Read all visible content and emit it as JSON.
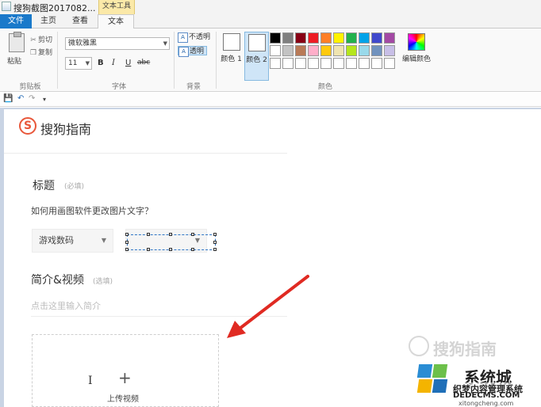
{
  "window": {
    "title": "搜狗截图2017082...",
    "context_tab": "文本工具"
  },
  "tabs": {
    "file": "文件",
    "home": "主页",
    "view": "查看",
    "text": "文本"
  },
  "ribbon": {
    "clipboard": {
      "paste": "粘贴",
      "cut": "剪切",
      "copy": "复制",
      "group": "剪贴板"
    },
    "font": {
      "family": "微软雅黑",
      "size": "11",
      "bold": "B",
      "italic": "I",
      "underline": "U",
      "strike": "abc",
      "group": "字体"
    },
    "background": {
      "opaque": "不透明",
      "transparent": "透明",
      "group": "背景"
    },
    "colors": {
      "color1": "颜色 1",
      "color2": "颜色 2",
      "edit": "编辑颜色",
      "group": "颜色",
      "palette": [
        "#000000",
        "#7f7f7f",
        "#880015",
        "#ed1c24",
        "#ff7f27",
        "#fff200",
        "#22b14c",
        "#00a2e8",
        "#3f48cc",
        "#a349a4",
        "#ffffff",
        "#c3c3c3",
        "#b97a57",
        "#ffaec9",
        "#ffc90e",
        "#efe4b0",
        "#b5e61d",
        "#99d9ea",
        "#7092be",
        "#c8bfe7",
        "#ffffff",
        "#ffffff",
        "#ffffff",
        "#ffffff",
        "#ffffff",
        "#ffffff",
        "#ffffff",
        "#ffffff",
        "#ffffff",
        "#ffffff"
      ]
    }
  },
  "page": {
    "logo_letter": "S",
    "logo_text": "搜狗指南",
    "title_label": "标题",
    "title_required": "(必填)",
    "title_value": "如何用画图软件更改图片文字？",
    "category": "游戏数码",
    "intro_label": "简介&视频",
    "intro_optional": "(选填)",
    "intro_placeholder": "点击这里输入简介",
    "upload_label": "上传视频",
    "watermark": "搜狗指南"
  },
  "site": {
    "name": "系统城",
    "sub1": "织梦内容管理系统",
    "sub2": "DEDECMS.COM",
    "sub3": "xitongcheng.com"
  }
}
